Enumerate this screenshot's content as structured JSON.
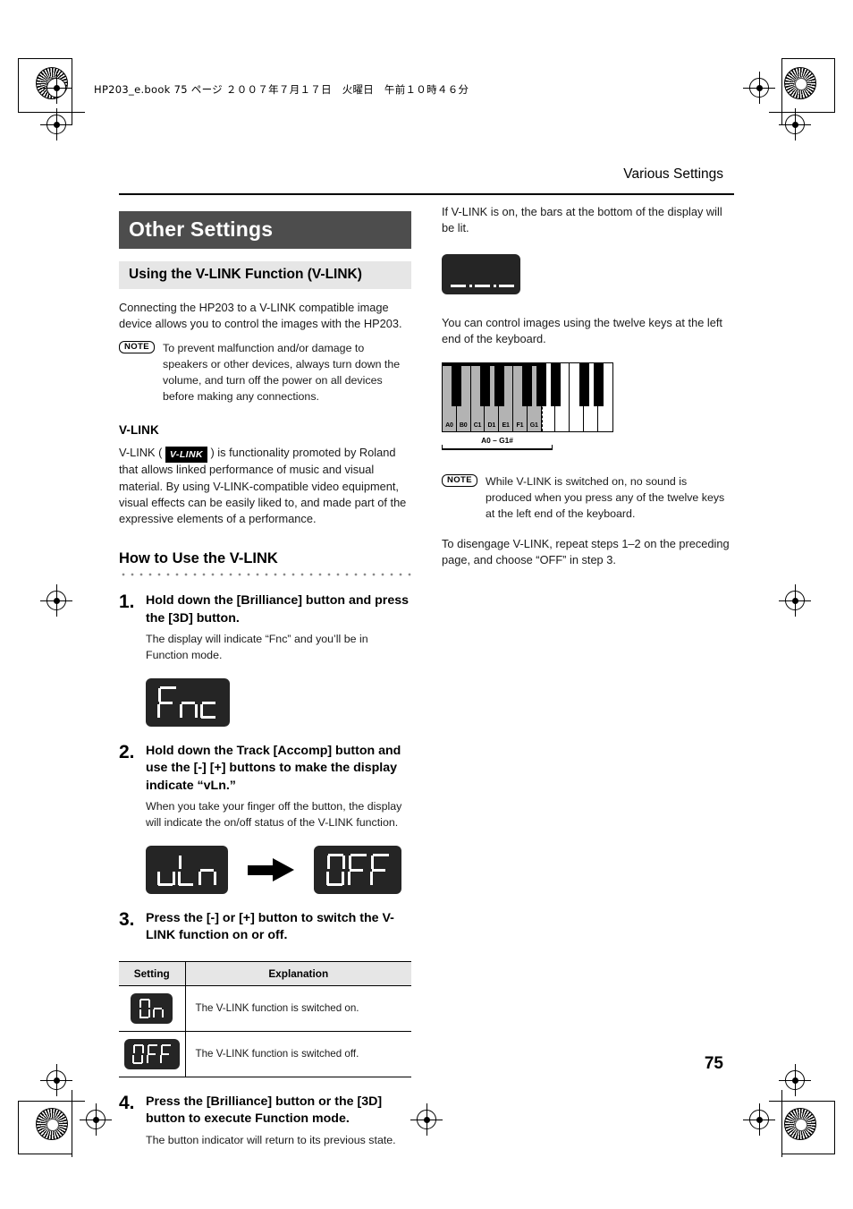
{
  "print_header": {
    "book_line": "HP203_e.book  75 ページ  ２００７年７月１７日　火曜日　午前１０時４６分"
  },
  "page": {
    "running_head": "Various Settings",
    "number": "75"
  },
  "left_column": {
    "section_title": "Other Settings",
    "subsection_title": "Using the V-LINK Function (V-LINK)",
    "intro": "Connecting the HP203 to a V-LINK compatible image device allows you to control the images with the HP203.",
    "note_badge": "NOTE",
    "note_text": "To prevent malfunction and/or damage to speakers or other devices, always turn down the volume, and turn off the power on all devices before making any connections.",
    "vlink_heading": "V-LINK",
    "vlink_logo_text": "V-LINK",
    "vlink_para_before": "V-LINK ( ",
    "vlink_para_after": " ) is functionality promoted by Roland that allows linked performance of music and visual material. By using V-LINK-compatible video equipment, visual effects can be easily liked to, and made part of the expressive elements of a performance.",
    "howto_heading": "How to Use the V-LINK",
    "steps": [
      {
        "num": "1.",
        "title": "Hold down the [Brilliance] button and press the [3D] button.",
        "desc": "The display will indicate “Fnc” and you’ll be in Function mode.",
        "display": "Fnc"
      },
      {
        "num": "2.",
        "title": "Hold down the Track [Accomp] button and use the [-] [+] buttons to make the display indicate “vLn.”",
        "desc": "When you take your finger off the button, the display will indicate the on/off status of the V-LINK function.",
        "display_from": "uLn",
        "arrow": "arrow-right-icon",
        "display_to": "OFF"
      },
      {
        "num": "3.",
        "title": "Press the [-] or [+] button to switch the V-LINK function on or off.",
        "desc": ""
      },
      {
        "num": "4.",
        "title": "Press the [Brilliance] button or the [3D] button to execute Function mode.",
        "desc": "The button indicator will return to its previous state."
      }
    ],
    "settings_table": {
      "headers": [
        "Setting",
        "Explanation"
      ],
      "rows": [
        {
          "setting_display": "On",
          "explanation": "The V-LINK function is switched on."
        },
        {
          "setting_display": "OFF",
          "explanation": "The V-LINK function is switched off."
        }
      ]
    }
  },
  "right_column": {
    "bars_para": "If V-LINK is on, the bars at the bottom of the display will be lit.",
    "bars_display": "bars-lit",
    "keys_para": "You can control images using the twelve keys at the left end of the keyboard.",
    "keyboard": {
      "key_labels": [
        "A0",
        "B0",
        "C1",
        "D1",
        "E1",
        "F1",
        "G1"
      ],
      "range_label": "A0 – G1#",
      "highlighted_white_keys": 7,
      "highlighted_black_keys": 5,
      "plain_white_keys": 5,
      "plain_black_keys": 3
    },
    "note_badge": "NOTE",
    "note_text": "While V-LINK is switched on, no sound is produced when you press any of the twelve keys at the left end of the keyboard.",
    "disengage_para": "To disengage V-LINK, repeat steps 1–2 on the preceding page, and choose “OFF” in step 3."
  },
  "colors": {
    "section_bar": "#4d4d4d",
    "sub_bar": "#e6e6e6",
    "lcd_bg": "#252525",
    "lcd_fg": "#ffffff",
    "key_highlight": "#b3b3b3"
  }
}
